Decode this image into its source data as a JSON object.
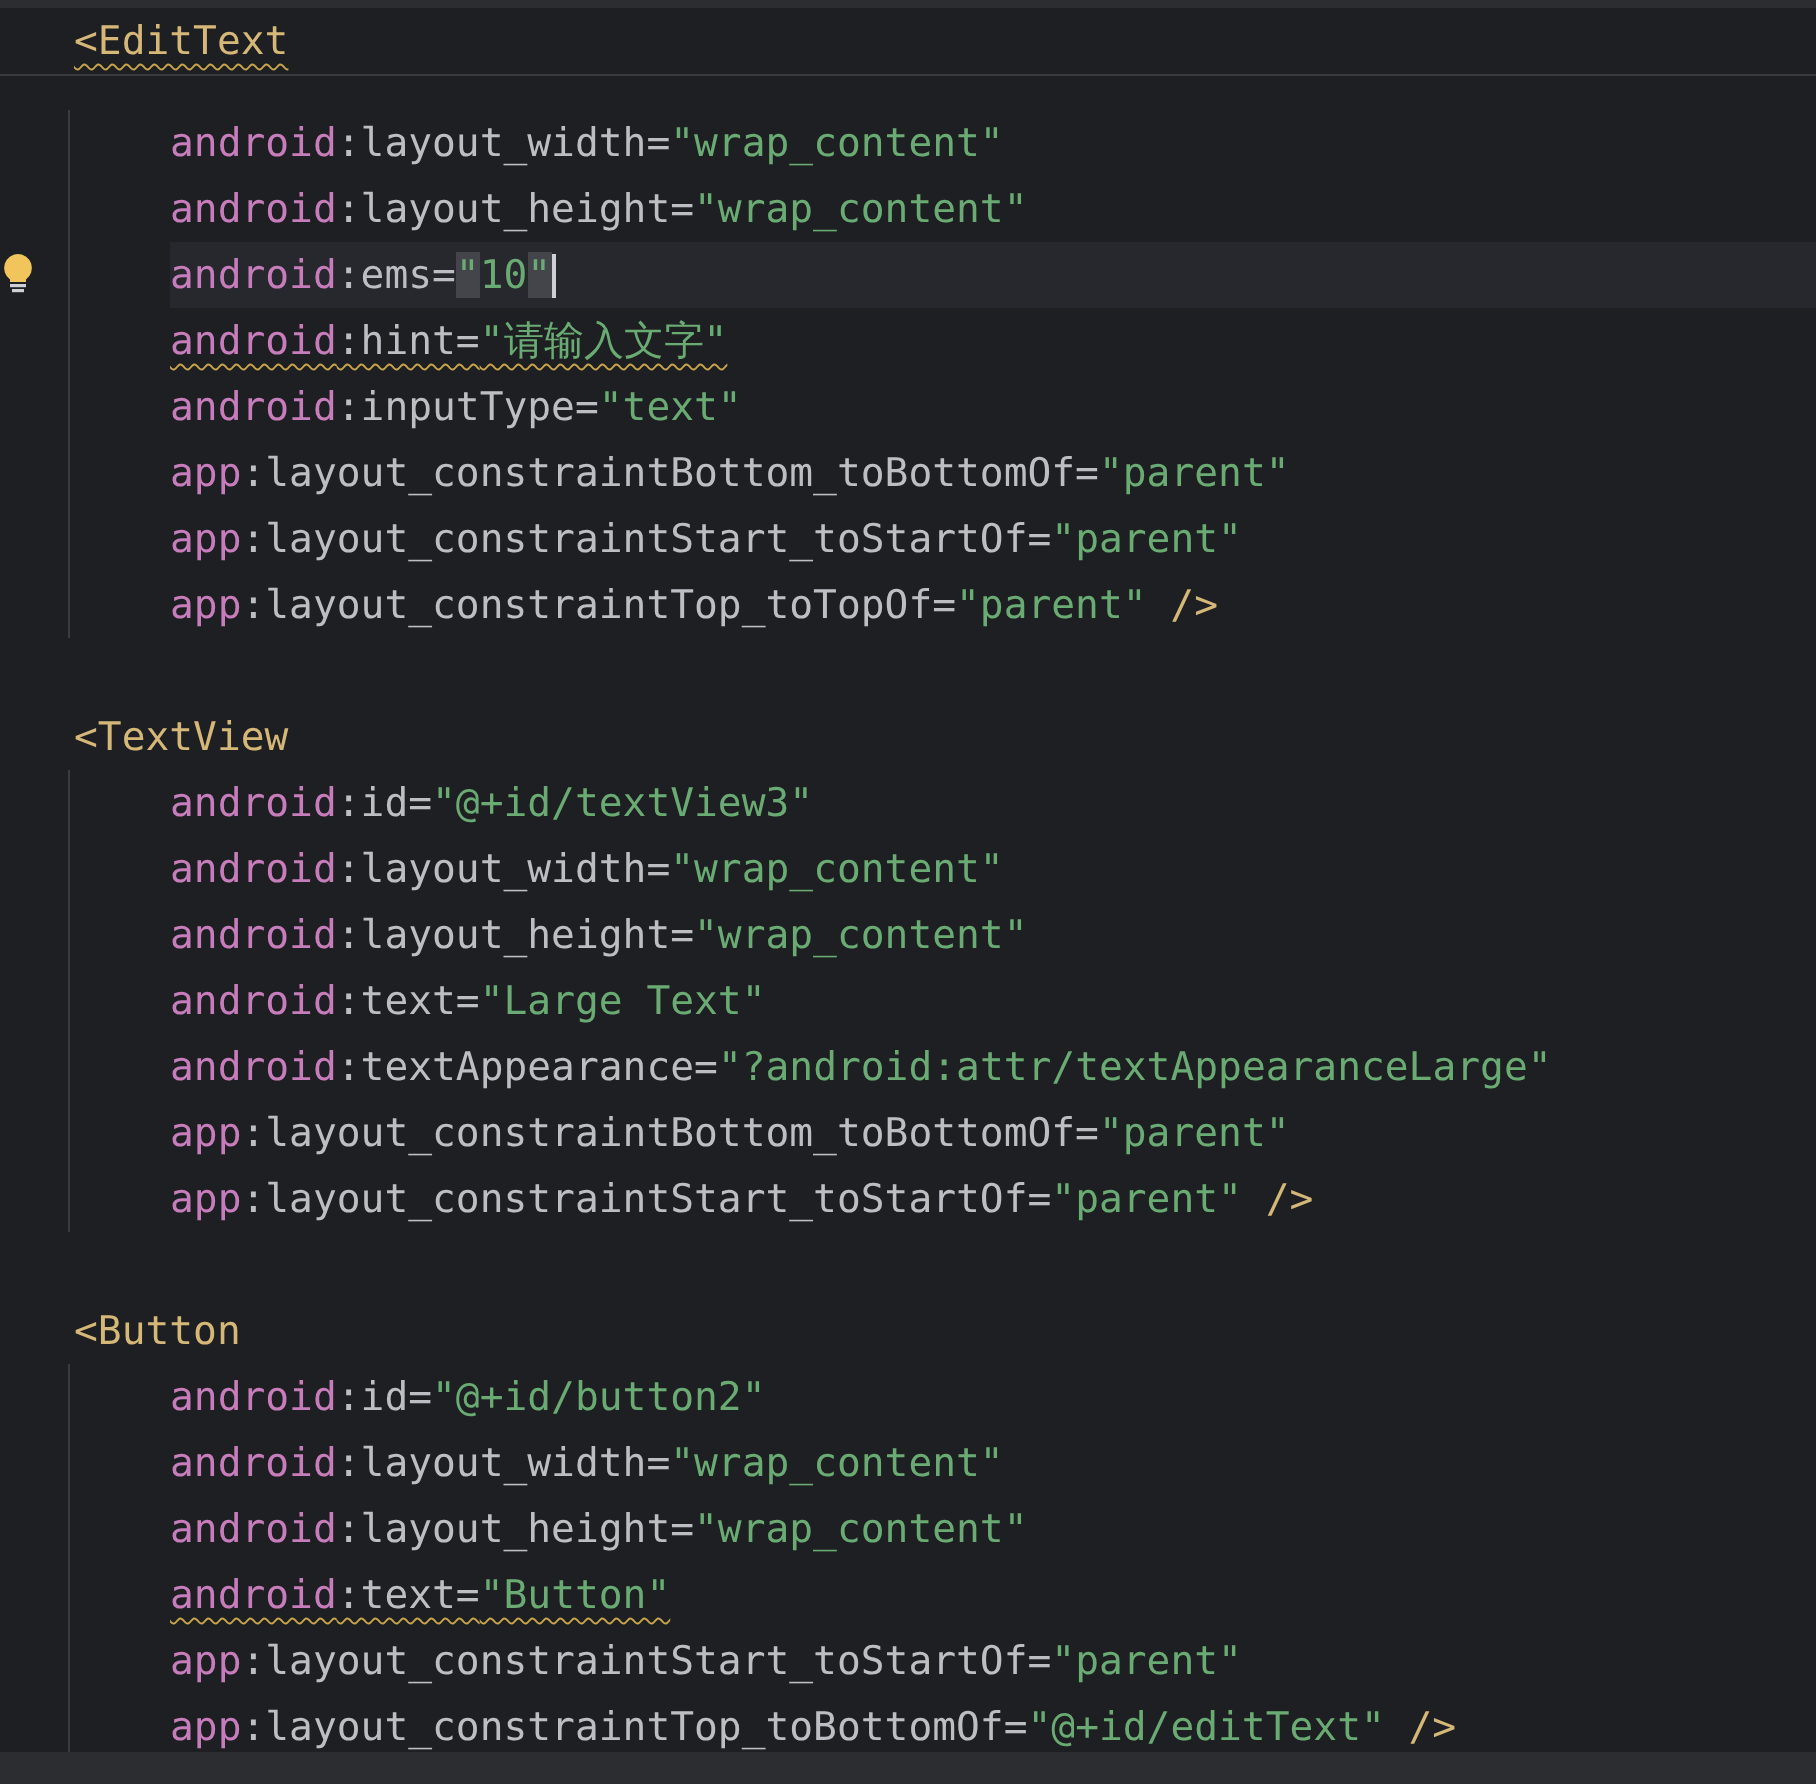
{
  "editor": {
    "elements": [
      {
        "tag": "<EditText",
        "warning": true,
        "attrs": [
          {
            "current": false,
            "warning": false,
            "tokens": [
              {
                "kind": "prefix",
                "text": "android"
              },
              {
                "kind": "plain",
                "text": ":layout_width="
              },
              {
                "kind": "value",
                "text": "\"wrap_content\""
              }
            ]
          },
          {
            "current": false,
            "warning": false,
            "tokens": [
              {
                "kind": "prefix",
                "text": "android"
              },
              {
                "kind": "plain",
                "text": ":layout_height="
              },
              {
                "kind": "value",
                "text": "\"wrap_content\""
              }
            ]
          },
          {
            "current": true,
            "warning": false,
            "tokens": [
              {
                "kind": "prefix",
                "text": "android"
              },
              {
                "kind": "plain",
                "text": ":ems="
              },
              {
                "kind": "value",
                "text": "\"10\""
              }
            ]
          },
          {
            "current": false,
            "warning": true,
            "tokens": [
              {
                "kind": "prefix",
                "text": "android"
              },
              {
                "kind": "plain",
                "text": ":hint="
              },
              {
                "kind": "value",
                "text": "\"请输入文字\""
              }
            ]
          },
          {
            "current": false,
            "warning": false,
            "tokens": [
              {
                "kind": "prefix",
                "text": "android"
              },
              {
                "kind": "plain",
                "text": ":inputType="
              },
              {
                "kind": "value",
                "text": "\"text\""
              }
            ]
          },
          {
            "current": false,
            "warning": false,
            "tokens": [
              {
                "kind": "prefix",
                "text": "app"
              },
              {
                "kind": "plain",
                "text": ":layout_constraintBottom_toBottomOf="
              },
              {
                "kind": "value",
                "text": "\"parent\""
              }
            ]
          },
          {
            "current": false,
            "warning": false,
            "tokens": [
              {
                "kind": "prefix",
                "text": "app"
              },
              {
                "kind": "plain",
                "text": ":layout_constraintStart_toStartOf="
              },
              {
                "kind": "value",
                "text": "\"parent\""
              }
            ]
          },
          {
            "current": false,
            "warning": false,
            "tokens": [
              {
                "kind": "prefix",
                "text": "app"
              },
              {
                "kind": "plain",
                "text": ":layout_constraintTop_toTopOf="
              },
              {
                "kind": "value",
                "text": "\"parent\""
              },
              {
                "kind": "close",
                "text": "/>"
              }
            ]
          }
        ]
      },
      {
        "tag": "<TextView",
        "warning": false,
        "attrs": [
          {
            "current": false,
            "warning": false,
            "tokens": [
              {
                "kind": "prefix",
                "text": "android"
              },
              {
                "kind": "plain",
                "text": ":id="
              },
              {
                "kind": "value",
                "text": "\"@+id/textView3\""
              }
            ]
          },
          {
            "current": false,
            "warning": false,
            "tokens": [
              {
                "kind": "prefix",
                "text": "android"
              },
              {
                "kind": "plain",
                "text": ":layout_width="
              },
              {
                "kind": "value",
                "text": "\"wrap_content\""
              }
            ]
          },
          {
            "current": false,
            "warning": false,
            "tokens": [
              {
                "kind": "prefix",
                "text": "android"
              },
              {
                "kind": "plain",
                "text": ":layout_height="
              },
              {
                "kind": "value",
                "text": "\"wrap_content\""
              }
            ]
          },
          {
            "current": false,
            "warning": false,
            "tokens": [
              {
                "kind": "prefix",
                "text": "android"
              },
              {
                "kind": "plain",
                "text": ":text="
              },
              {
                "kind": "value",
                "text": "\"Large Text\""
              }
            ]
          },
          {
            "current": false,
            "warning": false,
            "tokens": [
              {
                "kind": "prefix",
                "text": "android"
              },
              {
                "kind": "plain",
                "text": ":textAppearance="
              },
              {
                "kind": "value",
                "text": "\"?android:attr/textAppearanceLarge\""
              }
            ]
          },
          {
            "current": false,
            "warning": false,
            "tokens": [
              {
                "kind": "prefix",
                "text": "app"
              },
              {
                "kind": "plain",
                "text": ":layout_constraintBottom_toBottomOf="
              },
              {
                "kind": "value",
                "text": "\"parent\""
              }
            ]
          },
          {
            "current": false,
            "warning": false,
            "tokens": [
              {
                "kind": "prefix",
                "text": "app"
              },
              {
                "kind": "plain",
                "text": ":layout_constraintStart_toStartOf="
              },
              {
                "kind": "value",
                "text": "\"parent\""
              },
              {
                "kind": "close",
                "text": "/>"
              }
            ]
          }
        ]
      },
      {
        "tag": "<Button",
        "warning": false,
        "attrs": [
          {
            "current": false,
            "warning": false,
            "tokens": [
              {
                "kind": "prefix",
                "text": "android"
              },
              {
                "kind": "plain",
                "text": ":id="
              },
              {
                "kind": "value",
                "text": "\"@+id/button2\""
              }
            ]
          },
          {
            "current": false,
            "warning": false,
            "tokens": [
              {
                "kind": "prefix",
                "text": "android"
              },
              {
                "kind": "plain",
                "text": ":layout_width="
              },
              {
                "kind": "value",
                "text": "\"wrap_content\""
              }
            ]
          },
          {
            "current": false,
            "warning": false,
            "tokens": [
              {
                "kind": "prefix",
                "text": "android"
              },
              {
                "kind": "plain",
                "text": ":layout_height="
              },
              {
                "kind": "value",
                "text": "\"wrap_content\""
              }
            ]
          },
          {
            "current": false,
            "warning": true,
            "tokens": [
              {
                "kind": "prefix",
                "text": "android"
              },
              {
                "kind": "plain",
                "text": ":text="
              },
              {
                "kind": "value",
                "text": "\"Button\""
              }
            ]
          },
          {
            "current": false,
            "warning": false,
            "tokens": [
              {
                "kind": "prefix",
                "text": "app"
              },
              {
                "kind": "plain",
                "text": ":layout_constraintStart_toStartOf="
              },
              {
                "kind": "value",
                "text": "\"parent\""
              }
            ]
          },
          {
            "current": false,
            "warning": false,
            "tokens": [
              {
                "kind": "prefix",
                "text": "app"
              },
              {
                "kind": "plain",
                "text": ":layout_constraintTop_toBottomOf="
              },
              {
                "kind": "value",
                "text": "\"@+id/editText\""
              },
              {
                "kind": "close",
                "text": "/>"
              }
            ]
          }
        ]
      }
    ]
  }
}
